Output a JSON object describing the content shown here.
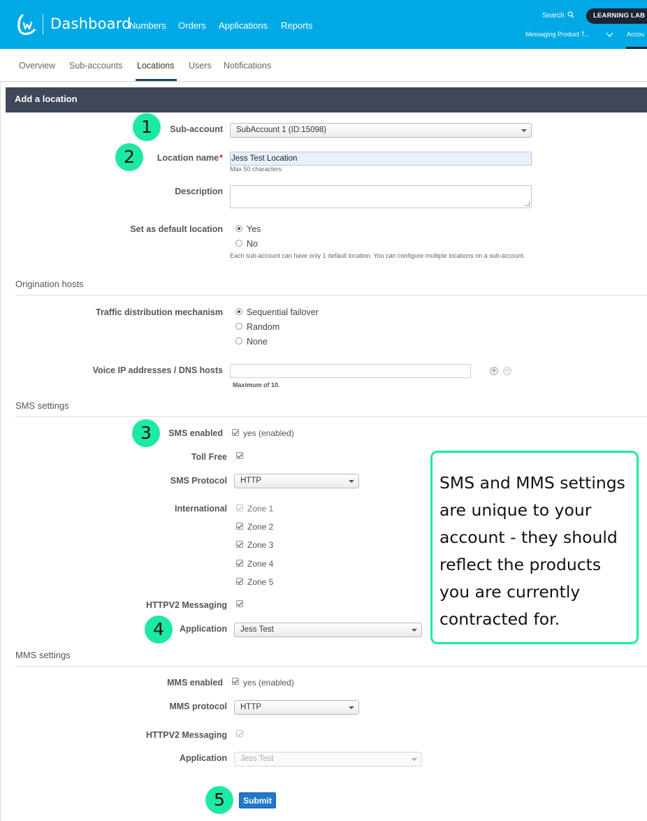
{
  "header": {
    "app_title": "Dashboard",
    "nav": [
      "Numbers",
      "Orders",
      "Applications",
      "Reports"
    ],
    "search_label": "Search",
    "learning_lab": "LEARNING LAB &",
    "account_selector": "Messaging Product T...",
    "account_tab": "Accou",
    "brand_color": "#00a9e6"
  },
  "subnav": {
    "tabs": [
      "Overview",
      "Sub-accounts",
      "Locations",
      "Users",
      "Notifications"
    ],
    "active": "Locations"
  },
  "form": {
    "title": "Add a location",
    "sub_account": {
      "label": "Sub-account",
      "value": "SubAccount 1 (ID:15098)"
    },
    "location_name": {
      "label": "Location name",
      "required_mark": "*",
      "value": "Jess Test Location",
      "hint": "Max 50 characters"
    },
    "description": {
      "label": "Description",
      "value": ""
    },
    "default_location": {
      "label": "Set as default location",
      "options": [
        "Yes",
        "No"
      ],
      "selected": "Yes",
      "hint": "Each sub-account can have only 1 default location. You can configure multiple locations on a sub-account."
    },
    "origination": {
      "title": "Origination hosts",
      "traffic_label": "Traffic distribution mechanism",
      "traffic_options": [
        "Sequential failover",
        "Random",
        "None"
      ],
      "traffic_selected": "Sequential failover",
      "voice_label": "Voice IP addresses / DNS hosts",
      "voice_value": "",
      "voice_hint": "Maximum of 10.",
      "add_glyph": "+",
      "remove_glyph": "−"
    },
    "sms": {
      "title": "SMS settings",
      "enabled_label": "SMS enabled",
      "enabled_text": "yes (enabled)",
      "enabled": true,
      "toll_free_label": "Toll Free",
      "toll_free": true,
      "protocol_label": "SMS Protocol",
      "protocol_value": "HTTP",
      "international_label": "International",
      "zones": [
        "Zone 1",
        "Zone 2",
        "Zone 3",
        "Zone 4",
        "Zone 5"
      ],
      "httpv2_label": "HTTPV2 Messaging",
      "httpv2": true,
      "application_label": "Application",
      "application_value": "Jess Test"
    },
    "mms": {
      "title": "MMS settings",
      "enabled_label": "MMS enabled",
      "enabled_text": "yes (enabled)",
      "enabled": true,
      "protocol_label": "MMS protocol",
      "protocol_value": "HTTP",
      "httpv2_label": "HTTPV2 Messaging",
      "httpv2": true,
      "application_label": "Application",
      "application_value": "Jess Test"
    },
    "submit_label": "Submit"
  },
  "annotations": {
    "badges": [
      "1",
      "2",
      "3",
      "4",
      "5"
    ],
    "badge_color": "#1de9a6",
    "callout_lines": [
      "SMS and MMS settings",
      "are unique to your",
      "account - they should",
      "reflect the products",
      "you are currently",
      "contracted for."
    ]
  }
}
